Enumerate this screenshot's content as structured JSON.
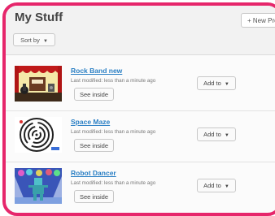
{
  "header": {
    "title": "My Stuff",
    "new_project_label": "+ New Pro",
    "sort_label": "Sort by"
  },
  "projects": [
    {
      "name": "Rock Band new",
      "modified": "Last modified: less than a minute ago",
      "see_inside_label": "See inside",
      "add_to_label": "Add to"
    },
    {
      "name": "Space Maze",
      "modified": "Last modified: less than a minute ago",
      "see_inside_label": "See inside",
      "add_to_label": "Add to"
    },
    {
      "name": "Robot Dancer",
      "modified": "Last modified: less than a minute ago",
      "see_inside_label": "See inside",
      "add_to_label": "Add to"
    }
  ],
  "colors": {
    "frame_border": "#e6266b",
    "link": "#2a7fc4"
  }
}
